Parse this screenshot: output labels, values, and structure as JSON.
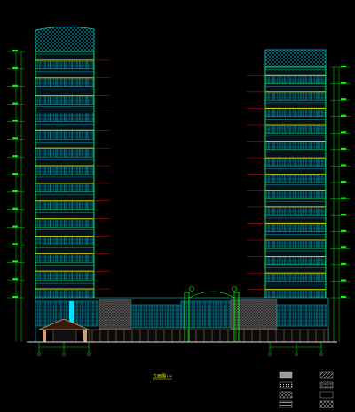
{
  "drawing": {
    "type": "cad-elevation",
    "background_color": "#000000",
    "floor_colors": {
      "glass": "#00c8d8",
      "slab": "#c8c800",
      "mullion": "#00ff66",
      "level_line": "#d01010",
      "dimension": "#00ff00",
      "stone": "#9a9a9a",
      "roof_mesh": "#00b4c8"
    },
    "title_block": {
      "title": "立面图",
      "scale": "1:100"
    },
    "legend_swatches": [
      {
        "pattern": "solid-gray"
      },
      {
        "pattern": "hatch-dots"
      },
      {
        "pattern": "cross-hatch"
      },
      {
        "pattern": "diagonal-hatch"
      },
      {
        "pattern": "brick"
      },
      {
        "pattern": "empty"
      },
      {
        "pattern": "stripes"
      },
      {
        "pattern": "dense-hatch"
      }
    ],
    "left_tower_floors": 14,
    "right_tower_floors": 14
  }
}
